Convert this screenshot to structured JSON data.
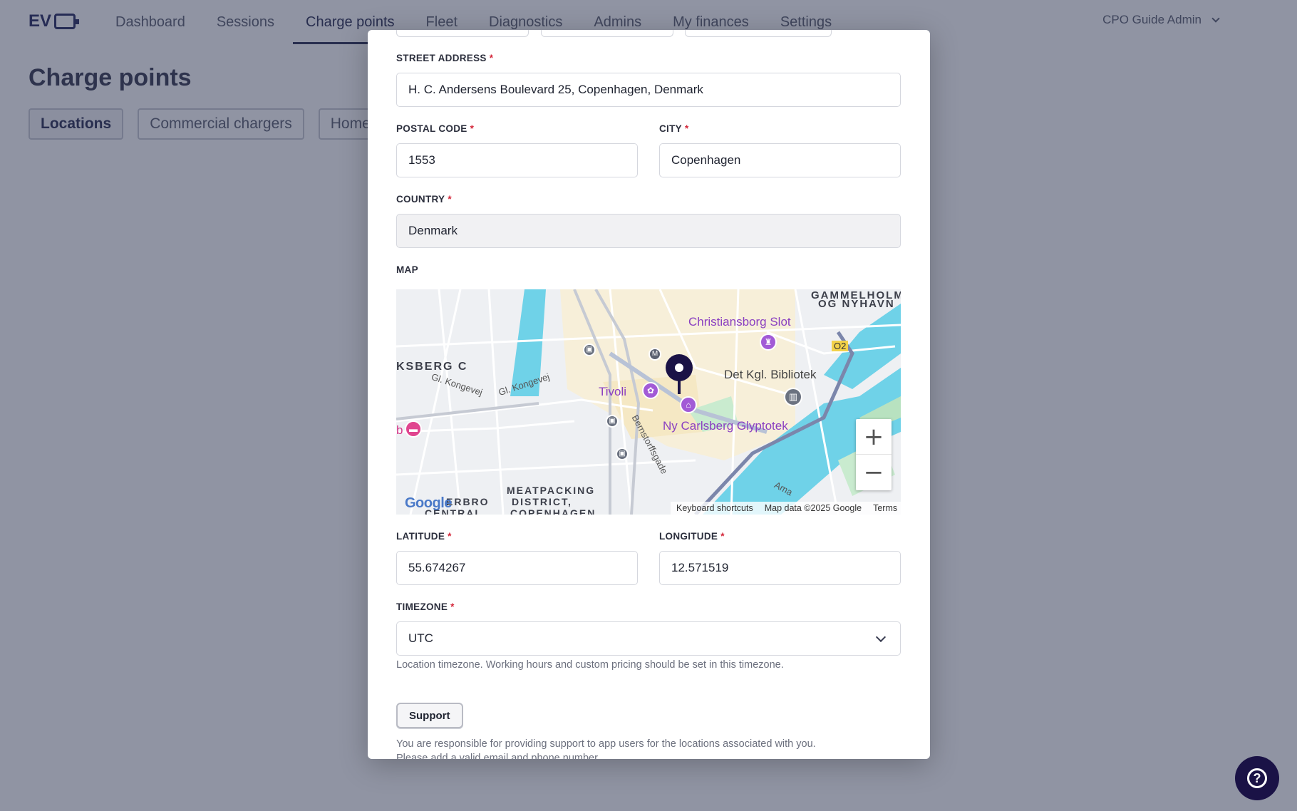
{
  "app": {
    "logo_text": "EV",
    "nav": [
      "Dashboard",
      "Sessions",
      "Charge points",
      "Fleet",
      "Diagnostics",
      "Admins",
      "My finances",
      "Settings"
    ],
    "active_nav": "Charge points",
    "user": "CPO Guide Admin"
  },
  "page": {
    "title": "Charge points",
    "tabs": [
      "Locations",
      "Commercial chargers",
      "Home"
    ]
  },
  "form": {
    "street_label": "STREET ADDRESS",
    "street_value": "H. C. Andersens Boulevard 25, Copenhagen, Denmark",
    "postal_label": "POSTAL CODE",
    "postal_value": "1553",
    "city_label": "CITY",
    "city_value": "Copenhagen",
    "country_label": "COUNTRY",
    "country_value": "Denmark",
    "map_label": "MAP",
    "latitude_label": "LATITUDE",
    "latitude_value": "55.674267",
    "longitude_label": "LONGITUDE",
    "longitude_value": "12.571519",
    "timezone_label": "TIMEZONE",
    "timezone_value": "UTC",
    "timezone_help": "Location timezone. Working hours and custom pricing should be set in this timezone.",
    "required_mark": "*",
    "support_button": "Support",
    "support_text_1": "You are responsible for providing support to app users for the locations associated with you.",
    "support_text_2": "Please add a valid email and phone number."
  },
  "map": {
    "labels": {
      "gammelholm_1": "GAMMELHOLM",
      "gammelholm_2": "OG NYHAVN",
      "christiansborg": "Christiansborg Slot",
      "ksberg": "KSBERG C",
      "kongevej_1": "Gl. Kongevej",
      "kongevej_2": "Gl. Kongevej",
      "tivoli": "Tivoli",
      "bibliotek": "Det Kgl. Bibliotek",
      "glyptotek": "Ny Carlsberg Glyptotek",
      "bernstorff": "Bernstorffsgade",
      "meatpacking_1": "MEATPACKING",
      "meatpacking_2": "DISTRICT,",
      "meatpacking_3": "COPENHAGEN",
      "erbro": "ERBRO",
      "central": "CENTRAL",
      "route": "O2",
      "metro": "M",
      "ama": "Ama",
      "b": "b"
    },
    "google": "Google",
    "footer": [
      "Keyboard shortcuts",
      "Map data ©2025 Google",
      "Terms"
    ],
    "zoom_in": "+",
    "zoom_out": "−"
  },
  "help_fab_glyph": "?"
}
